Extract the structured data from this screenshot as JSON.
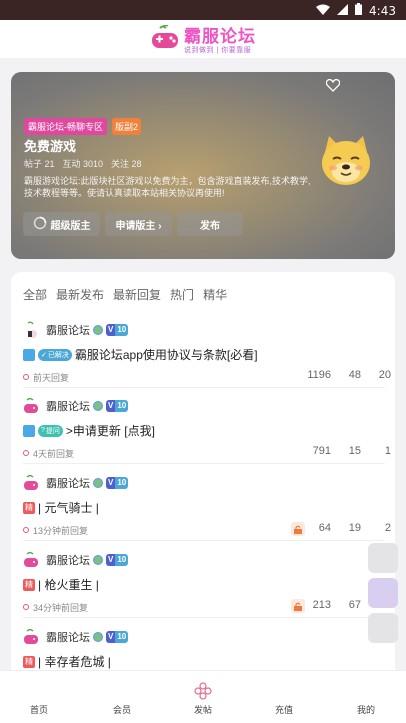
{
  "statusbar": {
    "time": "4:43"
  },
  "header": {
    "title": "霸服论坛",
    "subtitle": "说到做到 | 你要靠服"
  },
  "banner": {
    "tag_primary": "霸服论坛-畅聊专区",
    "tag_secondary": "版副2",
    "title": "免费游戏",
    "stats": {
      "posts": "帖子 21",
      "interactions": "互动 3010",
      "follows": "关注 28"
    },
    "description": "霸服游戏论坛:此版块社区游戏以免费为主，包含游戏直装发布,技术教学,技术教程等等。使请认真读取本站相关协议再使用!",
    "buttons": {
      "super_mod": "超级版主",
      "apply_mod": "申请版主 ›",
      "publish": "发布"
    }
  },
  "tabs": [
    "全部",
    "最新发布",
    "最新回复",
    "热门",
    "精华"
  ],
  "posts": [
    {
      "author": "霸服论坛",
      "level": "10",
      "badge": "已解决",
      "title": "霸服论坛app使用协议与条款[必看]",
      "time": "前天回复",
      "views": "1196",
      "replies": "48",
      "likes": "20"
    },
    {
      "author": "霸服论坛",
      "level": "10",
      "badge": "提问",
      "title": ">申请更新 [点我]",
      "time": "4天前回复",
      "views": "791",
      "replies": "15",
      "likes": "1"
    },
    {
      "author": "霸服论坛",
      "level": "10",
      "badge": "精",
      "title": "| 元气骑士 |",
      "time": "13分钟前回复",
      "views": "64",
      "replies": "19",
      "likes": "2"
    },
    {
      "author": "霸服论坛",
      "level": "10",
      "badge": "精",
      "title": "| 枪火重生 |",
      "time": "34分钟前回复",
      "views": "213",
      "replies": "67",
      "likes": ""
    },
    {
      "author": "霸服论坛",
      "level": "10",
      "badge": "精",
      "title": "| 幸存者危城 |",
      "time": "",
      "views": "",
      "replies": "",
      "likes": ""
    }
  ],
  "nav": {
    "home": "首页",
    "member": "会员",
    "post": "发帖",
    "recharge": "充值",
    "mine": "我的"
  },
  "colors": {
    "brand_pink": "#ee55c4",
    "tag_pink": "#e0479e",
    "tag_orange": "#f0813a",
    "level_v": "#4f5fd0",
    "level_n": "#4aa7d6"
  }
}
